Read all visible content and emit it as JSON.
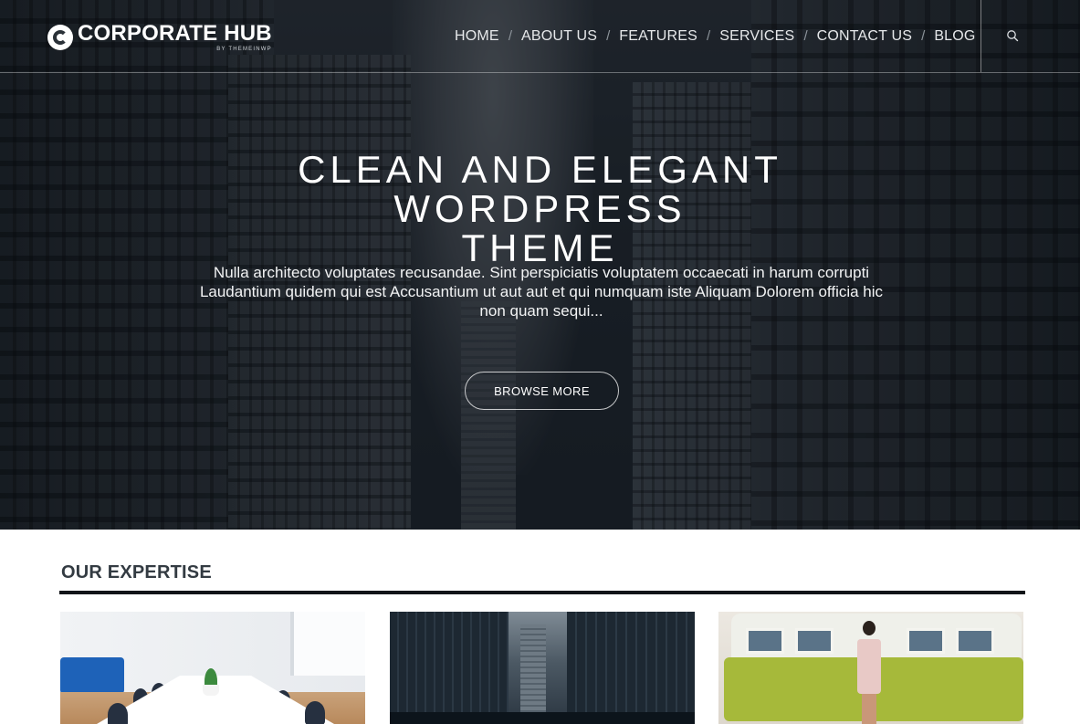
{
  "header": {
    "logo_title": "CORPORATE HUB",
    "logo_sub": "BY THEMEINWP",
    "nav": [
      {
        "label": "HOME"
      },
      {
        "label": "ABOUT US"
      },
      {
        "label": "FEATURES"
      },
      {
        "label": "SERVICES"
      },
      {
        "label": "CONTACT US"
      },
      {
        "label": "BLOG"
      }
    ],
    "separator": "/"
  },
  "hero": {
    "title_line1": "CLEAN AND ELEGANT WORDPRESS",
    "title_line2": "THEME",
    "text_line1": "Nulla architecto voluptates recusandae. Sint perspiciatis voluptatem occaecati in harum corrupti",
    "text_line2": "Laudantium quidem qui est Accusantium ut aut aut et qui numquam iste Aliquam Dolorem officia hic",
    "text_line3": "non quam sequi...",
    "button_label": "BROWSE MORE"
  },
  "expertise": {
    "title": "OUR EXPERTISE"
  },
  "colors": {
    "hero_overlay": "#0f141a",
    "rule": "#111418",
    "heading": "#333b42"
  },
  "icons": {
    "search": "search-icon",
    "logo": "logo-c-icon"
  }
}
